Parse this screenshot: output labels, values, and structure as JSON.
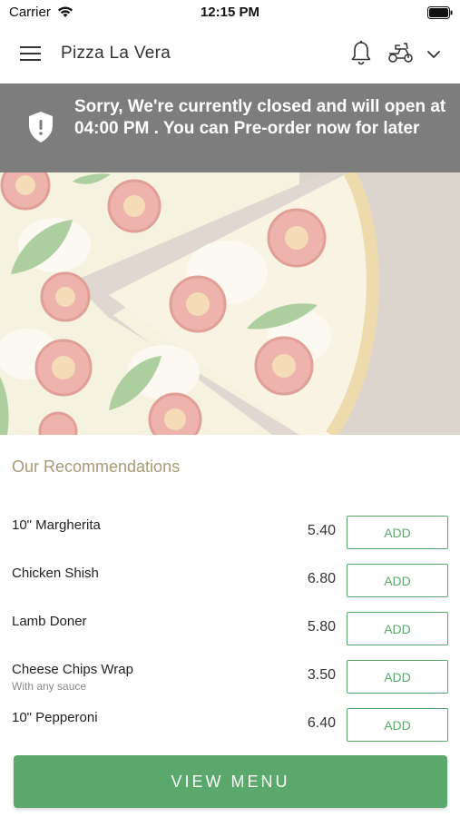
{
  "status_bar": {
    "carrier": "Carrier",
    "time": "12:15 PM"
  },
  "header": {
    "title": "Pizza La Vera",
    "icons": [
      "menu-icon",
      "bell-icon",
      "delivery-scooter-icon",
      "chevron-down-icon"
    ]
  },
  "banner": {
    "message": "Sorry, We're currently closed and will open at 04:00 PM . You can Pre-order now for later",
    "icon": "shield-alert-icon"
  },
  "recommendations": {
    "title": "Our Recommendations",
    "items": [
      {
        "name": "10\" Margherita",
        "subtitle": "",
        "price": "5.40",
        "button": "ADD"
      },
      {
        "name": "Chicken Shish",
        "subtitle": "",
        "price": "6.80",
        "button": "ADD"
      },
      {
        "name": "Lamb Doner",
        "subtitle": "",
        "price": "5.80",
        "button": "ADD"
      },
      {
        "name": "Cheese Chips Wrap",
        "subtitle": "With any sauce",
        "price": "3.50",
        "button": "ADD"
      },
      {
        "name": "10\" Pepperoni",
        "subtitle": "",
        "price": "6.40",
        "button": "ADD"
      }
    ]
  },
  "footer": {
    "view_menu": "VIEW MENU"
  },
  "colors": {
    "accent": "#5aa86c",
    "banner": "#7d7d7d",
    "section_title": "#a89a76"
  }
}
